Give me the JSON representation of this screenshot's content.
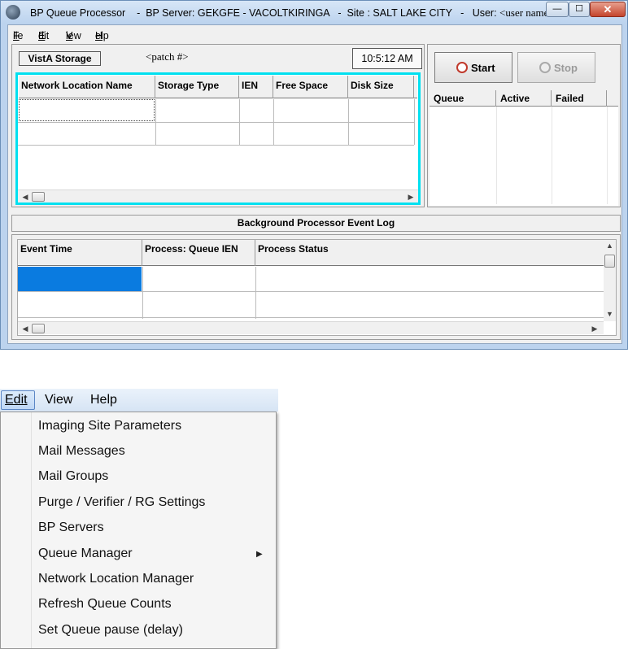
{
  "window": {
    "title": "BP Queue Processor    -  BP Server: GEKGFE - VACOLTKIRINGA   -  Site : SALT LAKE CITY   -   User:",
    "user": "<user name>",
    "min_glyph": "—",
    "max_glyph": "☐",
    "close_glyph": "✕"
  },
  "menubar": {
    "file_first": "F",
    "file_rest": "ile",
    "edit_first": "E",
    "edit_rest": "dit",
    "view_first": "V",
    "view_rest": "iew",
    "help_first": "H",
    "help_rest": "elp"
  },
  "storage_panel": {
    "vista_label": "VistA Storage",
    "patch_label": "<patch #>",
    "time": "10:5:12 AM",
    "columns": [
      "Network Location Name",
      "Storage Type",
      "IEN",
      "Free Space",
      "Disk Size"
    ]
  },
  "queue_panel": {
    "start_label": "Start",
    "stop_label": "Stop",
    "columns": [
      "Queue",
      "Active",
      "Failed"
    ]
  },
  "event_log": {
    "title": "Background Processor Event Log",
    "columns": [
      "Event Time",
      "Process: Queue IEN",
      "Process Status"
    ]
  },
  "edit_menu": {
    "bar": {
      "edit": "Edit",
      "view": "View",
      "help": "Help"
    },
    "items": [
      "Imaging Site Parameters",
      "Mail Messages",
      "Mail Groups",
      "Purge / Verifier / RG Settings",
      "BP Servers",
      "Queue Manager",
      "Network Location Manager",
      "Refresh Queue Counts",
      "Set Queue pause (delay)"
    ]
  },
  "colors": {
    "selection": "#0a7be0",
    "grid_focus_border": "#00e0f0",
    "window_frame": "#bcd3ee"
  }
}
